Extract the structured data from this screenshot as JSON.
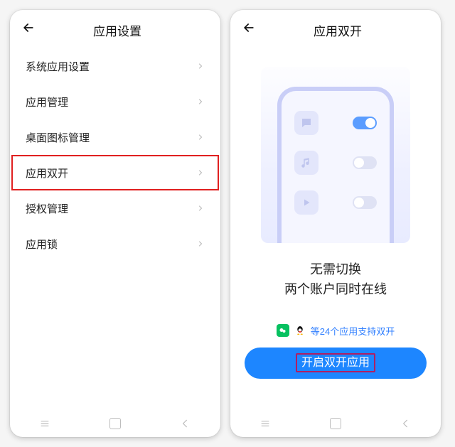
{
  "left": {
    "title": "应用设置",
    "items": [
      "系统应用设置",
      "应用管理",
      "桌面图标管理",
      "应用双开",
      "授权管理",
      "应用锁"
    ],
    "highlight_index": 3
  },
  "right": {
    "title": "应用双开",
    "hero_line1": "无需切换",
    "hero_line2": "两个账户同时在线",
    "apps_prefix": "等",
    "apps_count": "24",
    "apps_suffix": "个应用支持双开",
    "cta": "开启双开应用",
    "mock_rows": [
      {
        "icon": "chat",
        "on": true
      },
      {
        "icon": "music",
        "on": false
      },
      {
        "icon": "video",
        "on": false
      }
    ]
  }
}
